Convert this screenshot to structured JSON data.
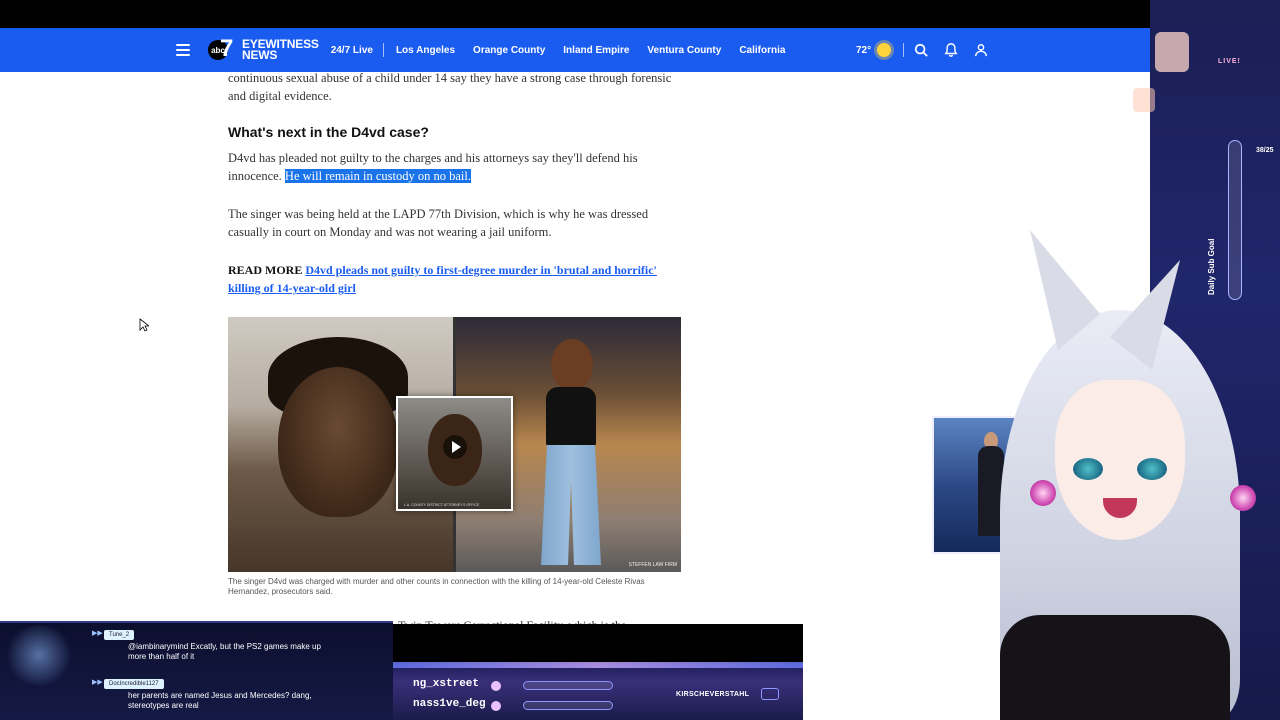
{
  "nav": {
    "logo_abc": "abc",
    "logo_seven": "7",
    "logo_line1": "EYEWITNESS",
    "logo_line2": "NEWS",
    "links": [
      "24/7 Live",
      "Los Angeles",
      "Orange County",
      "Inland Empire",
      "Ventura County",
      "California"
    ],
    "temperature": "72°",
    "icons": [
      "sun-icon",
      "search-icon",
      "bell-icon",
      "user-icon"
    ]
  },
  "article": {
    "intro": "continuous sexual abuse of a child under 14 say they have a strong case through forensic and digital evidence.",
    "heading": "What's next in the D4vd case?",
    "para1_plain": "D4vd has pleaded not guilty to the charges and his attorneys say they'll defend his innocence.",
    "para1_highlight": "He will remain in custody on no bail.",
    "para2": "The singer was being held at the LAPD 77th Division, which is why he was dressed casually in court on Monday and was not wearing a jail uniform.",
    "readmore_label": "READ MORE",
    "readmore_link": "D4vd pleads not guilty to first-degree murder in 'brutal and horrific' killing of 14-year-old girl",
    "media_caption": "The singer D4vd was charged with murder and other counts in connection with the killing of 14-year-old Celeste Rivas Hernandez, prosecutors said.",
    "mugshot_caption": "L.A. COUNTY DISTRICT ATTORNEY'S OFFICE",
    "photo_credit": "STEFFEN LAW FIRM",
    "cutoff_text": "Twin Towers Correctional Facility, which is the"
  },
  "stream": {
    "chat": [
      {
        "user": "Tune_2",
        "text": "@iambinarymind Excatly, but the PS2 games make up more than half of it"
      },
      {
        "user": "DocIncredible1127",
        "text": "her parents are named Jesus and Mercedes? dang, stereotypes are real"
      }
    ],
    "ticker_line1": "ng_xstreet",
    "ticker_line2": "nass1ve_deg",
    "channel_name": "KIRSCHEVERSTAHL",
    "live_label": "LIVE!",
    "sub_goal_label": "Daily Sub Goal",
    "sub_goal_count": "38/25"
  },
  "colors": {
    "nav_bg": "#1b5cf0",
    "highlight": "#1a73e8",
    "link": "#1b5cf0"
  }
}
